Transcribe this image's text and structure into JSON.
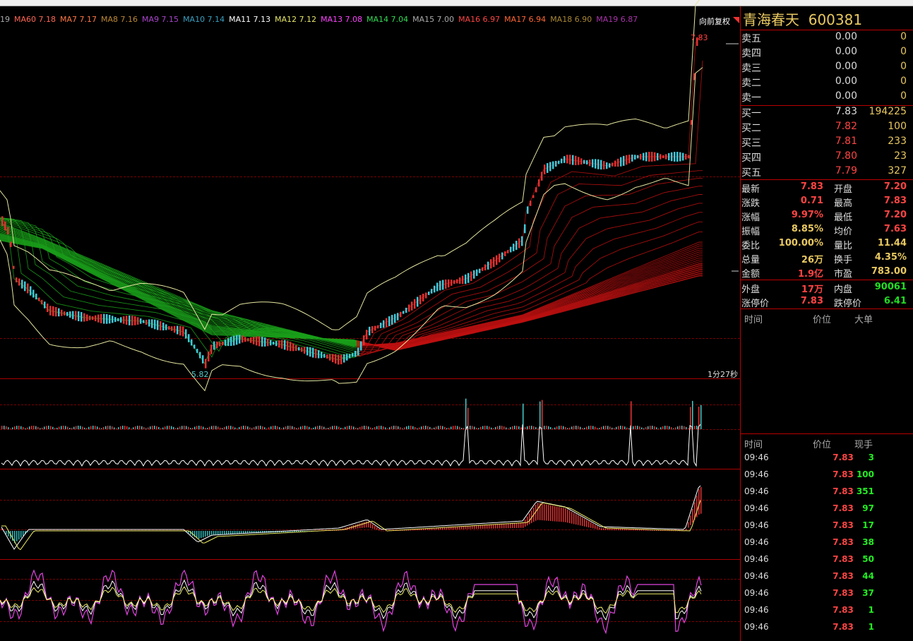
{
  "ma_legend": [
    {
      "label": "19",
      "color": "#aaaaaa"
    },
    {
      "label": "MA60 7.18",
      "color": "#ff6655"
    },
    {
      "label": "MA7 7.17",
      "color": "#ff7744"
    },
    {
      "label": "MA8 7.16",
      "color": "#bb8833"
    },
    {
      "label": "MA9 7.15",
      "color": "#aa44cc"
    },
    {
      "label": "MA10 7.14",
      "color": "#3aa0c0"
    },
    {
      "label": "MA11 7.13",
      "color": "#ffffff"
    },
    {
      "label": "MA12 7.12",
      "color": "#e6e66a"
    },
    {
      "label": "MA13 7.08",
      "color": "#ff44ff"
    },
    {
      "label": "MA14 7.04",
      "color": "#33dd55"
    },
    {
      "label": "MA15 7.00",
      "color": "#aaaaaa"
    },
    {
      "label": "MA16 6.97",
      "color": "#ff4444"
    },
    {
      "label": "MA17 6.94",
      "color": "#ff6633"
    },
    {
      "label": "MA18 6.90",
      "color": "#aa8833"
    },
    {
      "label": "MA19 6.87",
      "color": "#aa33aa"
    }
  ],
  "adjust_label": "向前复权",
  "high_label": "7.83",
  "low_label": "5.82",
  "period_label": "1分27秒",
  "stock": {
    "name": "青海春天",
    "code": "600381"
  },
  "sell_orders": [
    {
      "name": "卖五",
      "price": "0.00",
      "vol": "0"
    },
    {
      "name": "卖四",
      "price": "0.00",
      "vol": "0"
    },
    {
      "name": "卖三",
      "price": "0.00",
      "vol": "0"
    },
    {
      "name": "卖二",
      "price": "0.00",
      "vol": "0"
    },
    {
      "name": "卖一",
      "price": "0.00",
      "vol": "0"
    }
  ],
  "buy_orders": [
    {
      "name": "买一",
      "price": "7.83",
      "vol": "194225"
    },
    {
      "name": "买二",
      "price": "7.82",
      "vol": "100"
    },
    {
      "name": "买三",
      "price": "7.81",
      "vol": "233"
    },
    {
      "name": "买四",
      "price": "7.80",
      "vol": "23"
    },
    {
      "name": "买五",
      "price": "7.79",
      "vol": "327"
    }
  ],
  "stats": [
    {
      "k1": "最新",
      "v1": "7.83",
      "c1": "#ff4444",
      "k2": "开盘",
      "v2": "7.20",
      "c2": "#ff4444"
    },
    {
      "k1": "涨跌",
      "v1": "0.71",
      "c1": "#ff4444",
      "k2": "最高",
      "v2": "7.83",
      "c2": "#ff4444"
    },
    {
      "k1": "涨幅",
      "v1": "9.97%",
      "c1": "#ff4444",
      "k2": "最低",
      "v2": "7.20",
      "c2": "#ff4444"
    },
    {
      "k1": "振幅",
      "v1": "8.85%",
      "c1": "#e8c860",
      "k2": "均价",
      "v2": "7.63",
      "c2": "#ff4444"
    },
    {
      "k1": "委比",
      "v1": "100.00%",
      "c1": "#e8c860",
      "k2": "量比",
      "v2": "11.44",
      "c2": "#e8c860"
    },
    {
      "k1": "总量",
      "v1": "26万",
      "c1": "#e8c860",
      "k2": "换手",
      "v2": "4.35%",
      "c2": "#e8c860"
    },
    {
      "k1": "金额",
      "v1": "1.9亿",
      "c1": "#ff4444",
      "k2": "市盈",
      "v2": "783.00",
      "c2": "#e8c860"
    }
  ],
  "stats2": [
    {
      "k1": "外盘",
      "v1": "17万",
      "c1": "#ff4444",
      "k2": "内盘",
      "v2": "90061",
      "c2": "#22dd22"
    },
    {
      "k1": "涨停价",
      "v1": "7.83",
      "c1": "#ff4444",
      "k2": "跌停价",
      "v2": "6.41",
      "c2": "#22dd22"
    }
  ],
  "bigorder_headers": {
    "time": "时间",
    "price": "价位",
    "big": "大单"
  },
  "tick_headers": {
    "time": "时间",
    "price": "价位",
    "vol": "现手"
  },
  "ticks": [
    {
      "t": "09:46",
      "p": "7.83",
      "q": "3"
    },
    {
      "t": "09:46",
      "p": "7.83",
      "q": "100"
    },
    {
      "t": "09:46",
      "p": "7.83",
      "q": "351"
    },
    {
      "t": "09:46",
      "p": "7.83",
      "q": "97"
    },
    {
      "t": "09:46",
      "p": "7.83",
      "q": "17"
    },
    {
      "t": "09:46",
      "p": "7.83",
      "q": "38"
    },
    {
      "t": "09:46",
      "p": "7.83",
      "q": "50"
    },
    {
      "t": "09:46",
      "p": "7.83",
      "q": "44"
    },
    {
      "t": "09:46",
      "p": "7.83",
      "q": "37"
    },
    {
      "t": "09:46",
      "p": "7.83",
      "q": "1"
    },
    {
      "t": "09:46",
      "p": "7.83",
      "q": "1"
    }
  ]
}
